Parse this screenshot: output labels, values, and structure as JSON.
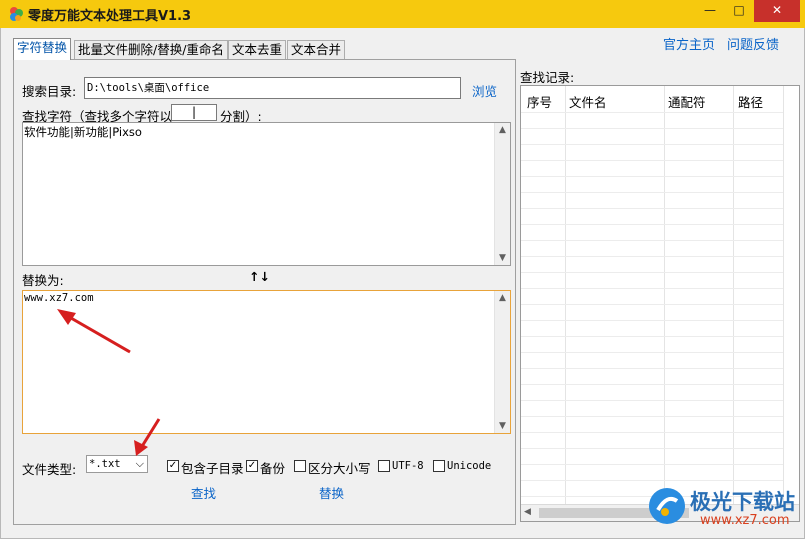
{
  "window": {
    "title": "零度万能文本处理工具V1.3",
    "minimize_glyph": "—",
    "maximize_glyph": "□",
    "close_glyph": "✕"
  },
  "tabs": [
    {
      "label": "字符替换",
      "active": true
    },
    {
      "label": "批量文件删除/替换/重命名",
      "active": false
    },
    {
      "label": "文本去重",
      "active": false
    },
    {
      "label": "文本合并",
      "active": false
    }
  ],
  "top_links": {
    "homepage": "官方主页",
    "feedback": "问题反馈"
  },
  "search": {
    "dir_label": "搜索目录:",
    "dir_value": "D:\\tools\\桌面\\office",
    "browse": "浏览",
    "find_label_a": "查找字符（查找多个字符以",
    "separator_value": "|",
    "find_label_b": "分割）:",
    "find_text": "软件功能|新功能|Pixso"
  },
  "replace": {
    "label": "替换为:",
    "swap_arrows": "↑↓",
    "text": "www.xz7.com"
  },
  "options": {
    "file_type_label": "文件类型:",
    "file_type_value": "*.txt",
    "include_subdirs": {
      "label": "包含子目录",
      "checked": true
    },
    "backup": {
      "label": "备份",
      "checked": true
    },
    "case_sensitive": {
      "label": "区分大小写",
      "checked": false
    },
    "utf8": {
      "label": "UTF-8",
      "checked": false
    },
    "unicode": {
      "label": "Unicode",
      "checked": false
    }
  },
  "actions": {
    "find": "查找",
    "replace": "替换"
  },
  "results": {
    "label": "查找记录:",
    "columns": [
      "序号",
      "文件名",
      "通配符",
      "路径"
    ]
  },
  "watermark": {
    "brand": "极光下载站",
    "url": "www.xz7.com"
  },
  "colors": {
    "titlebar": "#f6c90e",
    "link": "#0a64c8",
    "annotation_arrow": "#d61f1f",
    "close": "#c7302b"
  }
}
